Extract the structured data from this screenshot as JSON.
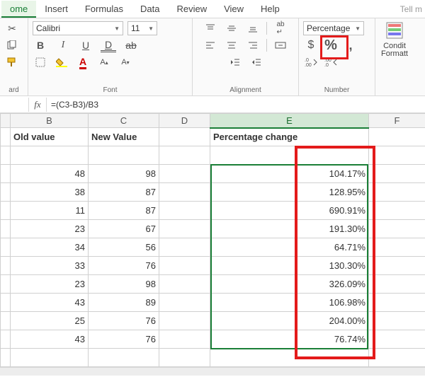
{
  "menu": {
    "tabs": [
      "ome",
      "Insert",
      "Formulas",
      "Data",
      "Review",
      "View",
      "Help"
    ],
    "active": 0,
    "tellme": "Tell m"
  },
  "ribbon": {
    "clipboard": {
      "label": "ard"
    },
    "font": {
      "name": "Calibri",
      "size": "11",
      "label": "Font"
    },
    "alignment": {
      "label": "Alignment"
    },
    "number": {
      "format": "Percentage",
      "currency": "$",
      "percent": "%",
      "comma": ",",
      "dec_inc": ".00",
      "dec_dec": ".00",
      "label": "Number"
    },
    "cf_label": "Condit\nFormatt"
  },
  "formula_bar": {
    "fx": "fx",
    "content": "=(C3-B3)/B3"
  },
  "columns": [
    "",
    "B",
    "C",
    "D",
    "E",
    "F"
  ],
  "headers": {
    "B": "Old value",
    "C": "New Value",
    "E": "Percentage change"
  },
  "rows": [
    {
      "b": "48",
      "c": "98",
      "e": "104.17%"
    },
    {
      "b": "38",
      "c": "87",
      "e": "128.95%"
    },
    {
      "b": "11",
      "c": "87",
      "e": "690.91%"
    },
    {
      "b": "23",
      "c": "67",
      "e": "191.30%"
    },
    {
      "b": "34",
      "c": "56",
      "e": "64.71%"
    },
    {
      "b": "33",
      "c": "76",
      "e": "130.30%"
    },
    {
      "b": "23",
      "c": "98",
      "e": "326.09%"
    },
    {
      "b": "43",
      "c": "89",
      "e": "106.98%"
    },
    {
      "b": "25",
      "c": "76",
      "e": "204.00%"
    },
    {
      "b": "43",
      "c": "76",
      "e": "76.74%"
    }
  ]
}
